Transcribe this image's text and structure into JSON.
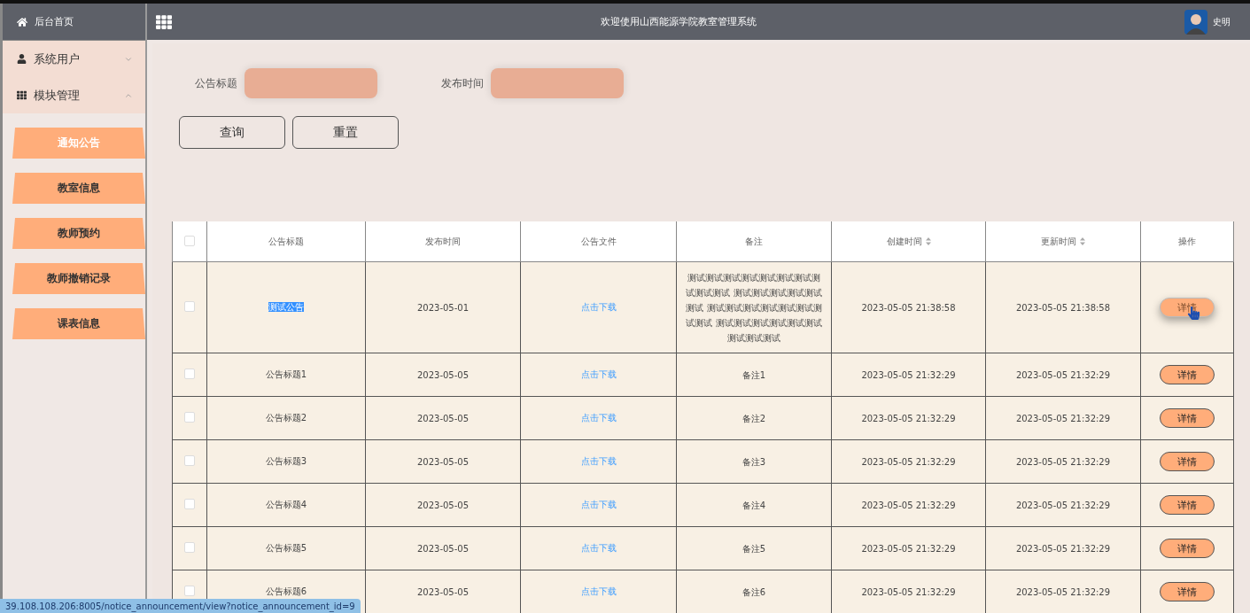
{
  "sidebar": {
    "home": {
      "label": "后台首页"
    },
    "groups": [
      {
        "label": "系统用户",
        "expanded": false
      },
      {
        "label": "模块管理",
        "expanded": true
      }
    ],
    "items": [
      {
        "label": "通知公告",
        "selected": true
      },
      {
        "label": "教室信息",
        "selected": false
      },
      {
        "label": "教师预约",
        "selected": false
      },
      {
        "label": "教师撤销记录",
        "selected": false
      },
      {
        "label": "课表信息",
        "selected": false
      }
    ]
  },
  "header": {
    "title": "欢迎使用山西能源学院教室管理系统",
    "user": "史明"
  },
  "filters": [
    {
      "label": "公告标题"
    },
    {
      "label": "发布时间"
    }
  ],
  "buttons": [
    "查询",
    "重置"
  ],
  "table": {
    "select_all": {
      "checked": false
    },
    "columns": [
      {
        "label": "公告标题",
        "sortable": false
      },
      {
        "label": "发布时间",
        "sortable": false
      },
      {
        "label": "公告文件",
        "sortable": false
      },
      {
        "label": "备注",
        "sortable": false
      },
      {
        "label": "创建时间",
        "sortable": true
      },
      {
        "label": "更新时间",
        "sortable": true
      },
      {
        "label": "操作",
        "sortable": false
      }
    ],
    "rows": [
      {
        "checked": false,
        "title": "测试公告",
        "title_highlighted": true,
        "published": "2023-05-01",
        "file": "点击下载",
        "remark": "测试测试测试测试测试测试测试测试测试测试 测试测试测试测试测试测试 测试测试测试测试测试测试测试测试 测试测试测试测试测试测试测试测试测试",
        "created": "2023-05-05 21:38:58",
        "updated": "2023-05-05 21:38:58",
        "action": "详情",
        "hovered": true
      },
      {
        "checked": false,
        "title": "公告标题1",
        "title_highlighted": false,
        "published": "2023-05-05",
        "file": "点击下载",
        "remark": "备注1",
        "created": "2023-05-05 21:32:29",
        "updated": "2023-05-05 21:32:29",
        "action": "详情",
        "hovered": false
      },
      {
        "checked": false,
        "title": "公告标题2",
        "title_highlighted": false,
        "published": "2023-05-05",
        "file": "点击下载",
        "remark": "备注2",
        "created": "2023-05-05 21:32:29",
        "updated": "2023-05-05 21:32:29",
        "action": "详情",
        "hovered": false
      },
      {
        "checked": false,
        "title": "公告标题3",
        "title_highlighted": false,
        "published": "2023-05-05",
        "file": "点击下载",
        "remark": "备注3",
        "created": "2023-05-05 21:32:29",
        "updated": "2023-05-05 21:32:29",
        "action": "详情",
        "hovered": false
      },
      {
        "checked": false,
        "title": "公告标题4",
        "title_highlighted": false,
        "published": "2023-05-05",
        "file": "点击下载",
        "remark": "备注4",
        "created": "2023-05-05 21:32:29",
        "updated": "2023-05-05 21:32:29",
        "action": "详情",
        "hovered": false
      },
      {
        "checked": false,
        "title": "公告标题5",
        "title_highlighted": false,
        "published": "2023-05-05",
        "file": "点击下载",
        "remark": "备注5",
        "created": "2023-05-05 21:32:29",
        "updated": "2023-05-05 21:32:29",
        "action": "详情",
        "hovered": false
      },
      {
        "checked": false,
        "title": "公告标题6",
        "title_highlighted": false,
        "published": "2023-05-05",
        "file": "点击下载",
        "remark": "备注6",
        "created": "2023-05-05 21:32:29",
        "updated": "2023-05-05 21:32:29",
        "action": "详情",
        "hovered": false
      }
    ]
  },
  "status_bar": {
    "url": "39.108.108.206:8005/notice_announcement/view?notice_announcement_id=9"
  }
}
